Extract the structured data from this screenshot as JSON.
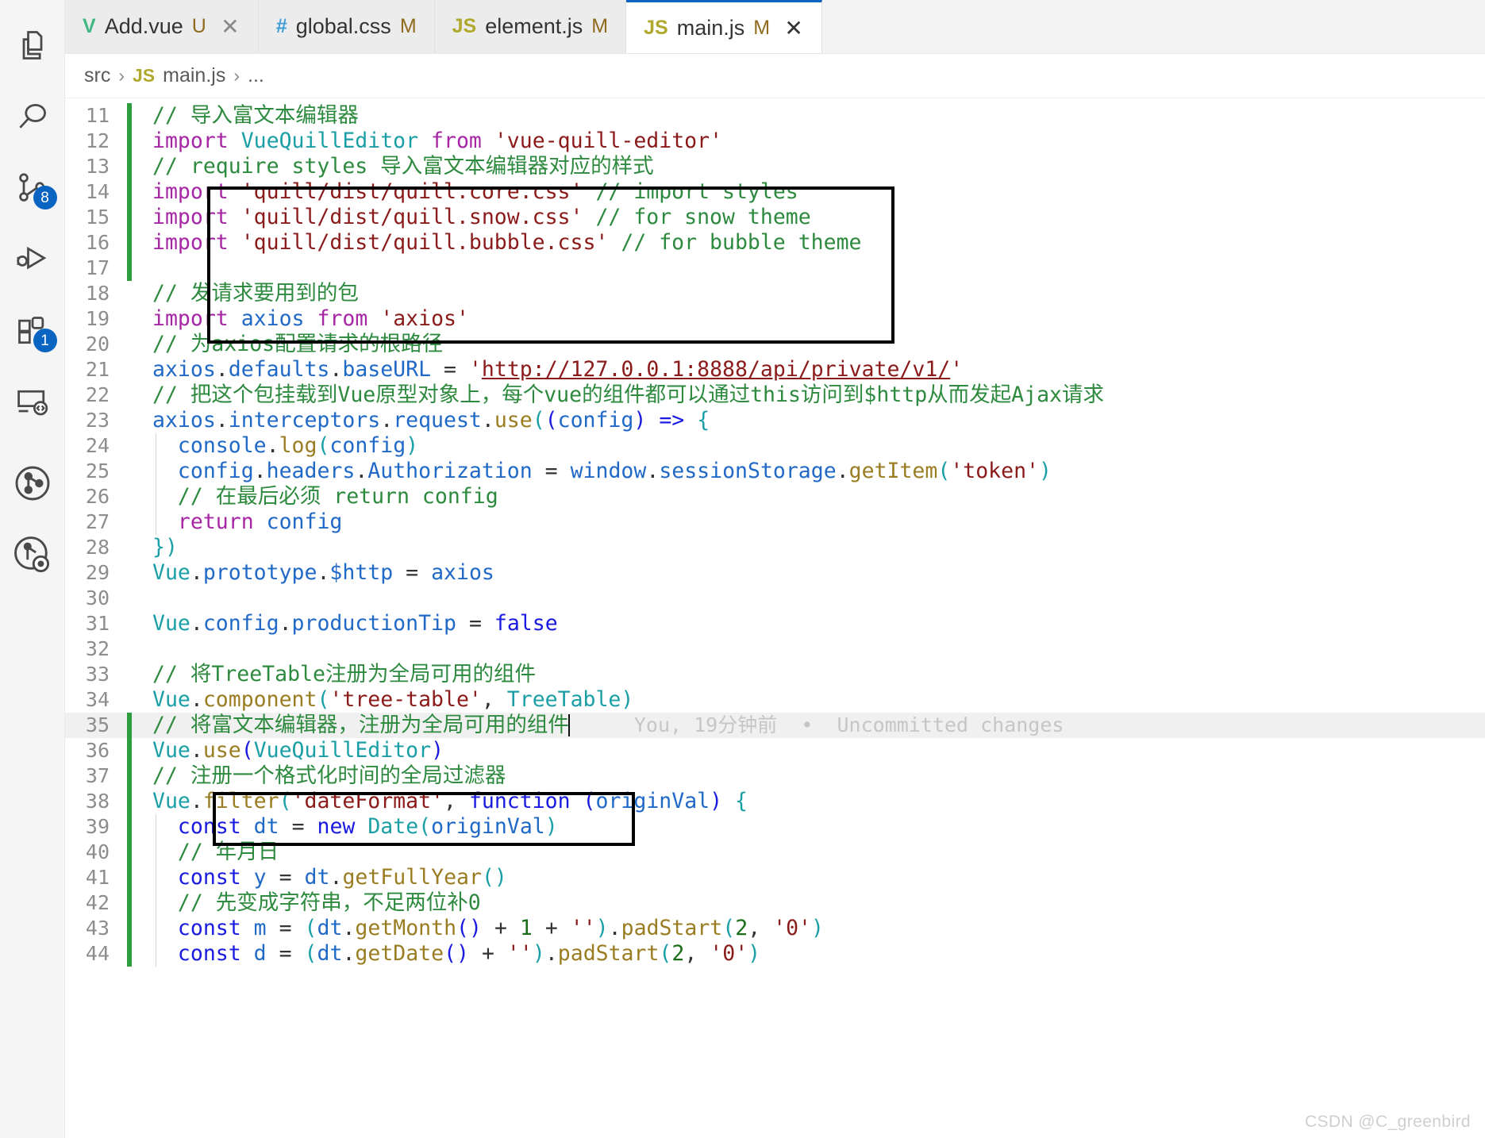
{
  "activity_bar": {
    "items": [
      {
        "name": "explorer",
        "icon": "files-icon",
        "badge": null
      },
      {
        "name": "search",
        "icon": "search-icon",
        "badge": null
      },
      {
        "name": "source-control",
        "icon": "source-control-icon",
        "badge": "8"
      },
      {
        "name": "run-and-debug",
        "icon": "run-debug-icon",
        "badge": null
      },
      {
        "name": "extensions",
        "icon": "extensions-icon",
        "badge": "1"
      },
      {
        "name": "remote-explorer",
        "icon": "remote-explorer-icon",
        "badge": null
      },
      {
        "name": "git-graph",
        "icon": "git-graph-icon",
        "badge": null
      },
      {
        "name": "git-graph-search",
        "icon": "git-graph-search-icon",
        "badge": null
      }
    ]
  },
  "tabs": [
    {
      "icon": "V",
      "icon_kind": "vue",
      "name": "Add.vue",
      "status": "U",
      "active": false,
      "closable": true
    },
    {
      "icon": "#",
      "icon_kind": "css",
      "name": "global.css",
      "status": "M",
      "active": false,
      "closable": false
    },
    {
      "icon": "JS",
      "icon_kind": "js",
      "name": "element.js",
      "status": "M",
      "active": false,
      "closable": false
    },
    {
      "icon": "JS",
      "icon_kind": "js",
      "name": "main.js",
      "status": "M",
      "active": true,
      "closable": true
    }
  ],
  "breadcrumb": {
    "root": "src",
    "sep": "›",
    "file_icon": "JS",
    "file": "main.js",
    "tail": "..."
  },
  "blame": {
    "line": 35,
    "text": "You, 19分钟前  •  Uncommitted changes"
  },
  "annotations": [
    {
      "name": "highlight-box-imports",
      "lines": "11-16"
    },
    {
      "name": "highlight-box-quill-register",
      "lines": "35-36"
    }
  ],
  "watermark": "CSDN @C_greenbird",
  "code": {
    "language": "javascript",
    "file": "main.js",
    "first_visible_line": 11,
    "last_visible_line": 44,
    "cursor_line": 35,
    "lines": [
      {
        "n": 11,
        "added": true,
        "text": "// 导入富文本编辑器"
      },
      {
        "n": 12,
        "added": true,
        "text": "import VueQuillEditor from 'vue-quill-editor'"
      },
      {
        "n": 13,
        "added": true,
        "text": "// require styles 导入富文本编辑器对应的样式"
      },
      {
        "n": 14,
        "added": true,
        "text": "import 'quill/dist/quill.core.css' // import styles"
      },
      {
        "n": 15,
        "added": true,
        "text": "import 'quill/dist/quill.snow.css' // for snow theme"
      },
      {
        "n": 16,
        "added": true,
        "text": "import 'quill/dist/quill.bubble.css' // for bubble theme"
      },
      {
        "n": 17,
        "added": true,
        "text": ""
      },
      {
        "n": 18,
        "added": false,
        "text": "// 发请求要用到的包"
      },
      {
        "n": 19,
        "added": false,
        "text": "import axios from 'axios'"
      },
      {
        "n": 20,
        "added": false,
        "text": "// 为axios配置请求的根路径"
      },
      {
        "n": 21,
        "added": false,
        "text": "axios.defaults.baseURL = 'http://127.0.0.1:8888/api/private/v1/'"
      },
      {
        "n": 22,
        "added": false,
        "text": "// 把这个包挂载到Vue原型对象上，每个vue的组件都可以通过this访问到$http从而发起Ajax请求"
      },
      {
        "n": 23,
        "added": false,
        "text": "axios.interceptors.request.use((config) => {"
      },
      {
        "n": 24,
        "added": false,
        "text": "  console.log(config)"
      },
      {
        "n": 25,
        "added": false,
        "text": "  config.headers.Authorization = window.sessionStorage.getItem('token')"
      },
      {
        "n": 26,
        "added": false,
        "text": "  // 在最后必须 return config"
      },
      {
        "n": 27,
        "added": false,
        "text": "  return config"
      },
      {
        "n": 28,
        "added": false,
        "text": "})"
      },
      {
        "n": 29,
        "added": false,
        "text": "Vue.prototype.$http = axios"
      },
      {
        "n": 30,
        "added": false,
        "text": ""
      },
      {
        "n": 31,
        "added": false,
        "text": "Vue.config.productionTip = false"
      },
      {
        "n": 32,
        "added": false,
        "text": ""
      },
      {
        "n": 33,
        "added": false,
        "text": "// 将TreeTable注册为全局可用的组件"
      },
      {
        "n": 34,
        "added": false,
        "text": "Vue.component('tree-table', TreeTable)"
      },
      {
        "n": 35,
        "added": true,
        "text": "// 将富文本编辑器，注册为全局可用的组件"
      },
      {
        "n": 36,
        "added": true,
        "text": "Vue.use(VueQuillEditor)"
      },
      {
        "n": 37,
        "added": true,
        "text": "// 注册一个格式化时间的全局过滤器"
      },
      {
        "n": 38,
        "added": true,
        "text": "Vue.filter('dateFormat', function (originVal) {"
      },
      {
        "n": 39,
        "added": true,
        "text": "  const dt = new Date(originVal)"
      },
      {
        "n": 40,
        "added": true,
        "text": "  // 年月日"
      },
      {
        "n": 41,
        "added": true,
        "text": "  const y = dt.getFullYear()"
      },
      {
        "n": 42,
        "added": true,
        "text": "  // 先变成字符串，不足两位补0"
      },
      {
        "n": 43,
        "added": true,
        "text": "  const m = (dt.getMonth() + 1 + '').padStart(2, '0')"
      },
      {
        "n": 44,
        "added": true,
        "text": "  const d = (dt.getDate() + '').padStart(2, '0')"
      }
    ]
  },
  "colors": {
    "accent": "#0a64c2",
    "added_gutter": "#2d9e40",
    "comment": "#2d8a3e",
    "keyword": "#a626a4",
    "string": "#8b1a1a",
    "identifier": "#2169c7",
    "type": "#1a9fa6",
    "blame_text": "#c6c6c6"
  }
}
